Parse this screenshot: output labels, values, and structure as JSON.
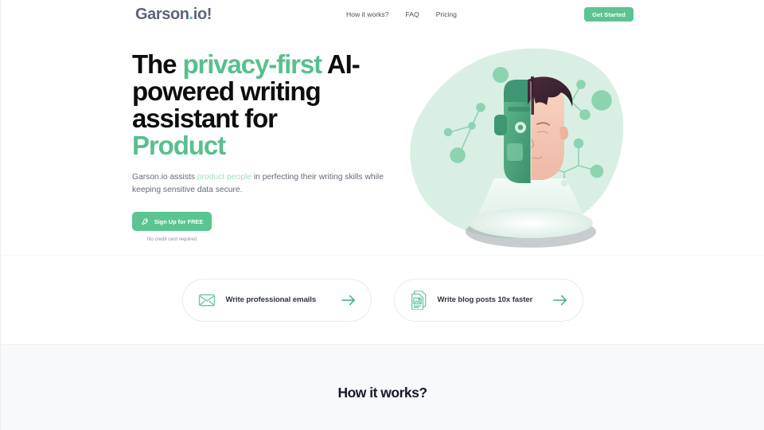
{
  "brand": {
    "name_part1": "Garson",
    "name_dot": ".",
    "name_part2": "io!",
    "accent_color": "#57c08d",
    "logo_color": "#5e6377"
  },
  "header": {
    "nav": [
      {
        "label": "How it works?",
        "name": "nav-how-it-works"
      },
      {
        "label": "FAQ",
        "name": "nav-faq"
      },
      {
        "label": "Pricing",
        "name": "nav-pricing"
      }
    ],
    "cta_label": "Get Started"
  },
  "hero": {
    "headline": {
      "line1_plain": "The ",
      "line1_accent": "privacy-first",
      "line1_tail": " AI-",
      "line2": "powered writing",
      "line3": "assistant for",
      "line4_accent": "Product"
    },
    "subtitle": {
      "pre": "Garson.io assists ",
      "highlight": "product people",
      "post": " in perfecting their writing skills while keeping sensitive data secure."
    },
    "signup_label": "Sign Up for FREE",
    "signup_icon": "rocket-icon",
    "no_credit_note": "No credit card required",
    "illustration": {
      "name": "ai-hologram-illustration",
      "description": "Half robot half human head hologram projected above a disc on a mint blob background with network nodes",
      "blob_color": "#d9efe4",
      "robot_color": "#4ca57d",
      "hair_color": "#3a2230",
      "skin_color": "#f5c9b6",
      "node_color": "#8ed3b0"
    }
  },
  "cards": [
    {
      "label": "Write professional emails",
      "icon": "envelope-icon",
      "arrow_icon": "arrow-right-icon",
      "name": "card-write-professional-emails"
    },
    {
      "label": "Write blog posts 10x faster",
      "icon": "document-image-icon",
      "arrow_icon": "arrow-right-icon",
      "name": "card-write-blog-posts"
    }
  ],
  "how_section": {
    "title": "How it works?",
    "background": "#f7f9fa"
  }
}
